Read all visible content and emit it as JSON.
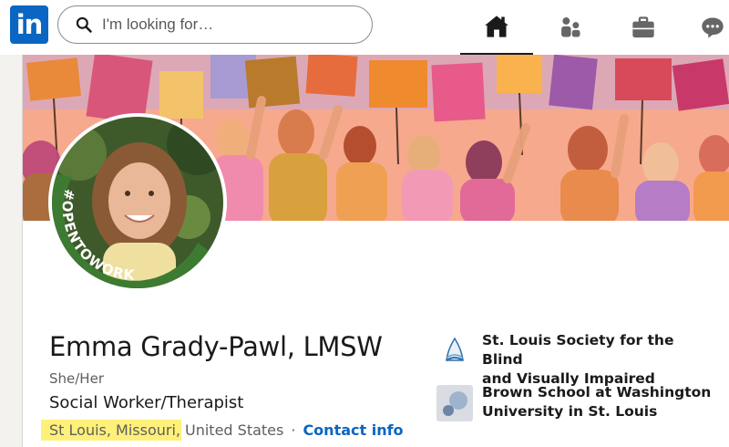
{
  "nav": {
    "logo_text": "in",
    "search_placeholder": "I'm looking for…",
    "icons": [
      "home-icon",
      "my-network-icon",
      "jobs-icon",
      "messaging-icon"
    ]
  },
  "profile": {
    "badge_text": "#OPENTOWORK",
    "name": "Emma Grady-Pawl, LMSW",
    "pronouns": "She/Her",
    "headline": "Social Worker/Therapist",
    "location_city": "St Louis, Missouri,",
    "location_country": "United States",
    "separator": "·",
    "contact_label": "Contact info"
  },
  "organizations": [
    {
      "name_line1": "St. Louis Society for the Blind",
      "name_line2": "and Visually Impaired"
    },
    {
      "name_line1": "Brown School at Washington",
      "name_line2": "University in St. Louis"
    }
  ],
  "colors": {
    "brand": "#0a66c2",
    "open_to_work_green": "#3d7a32",
    "highlight": "#fff07a"
  }
}
